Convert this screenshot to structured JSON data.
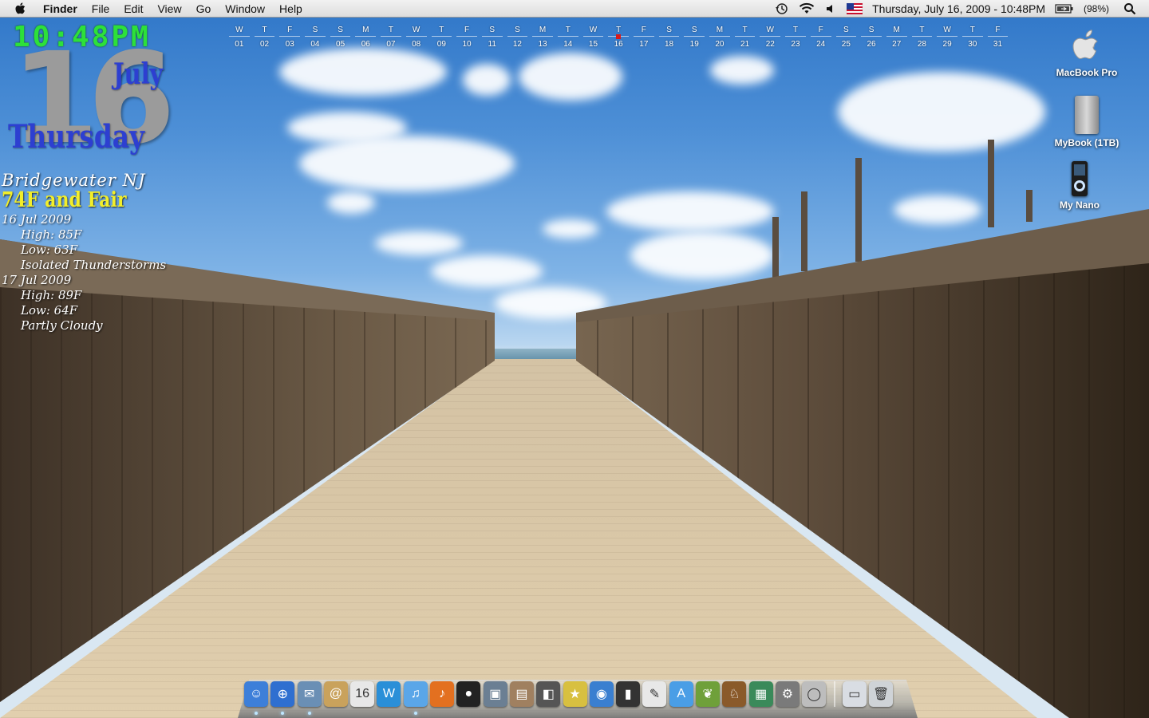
{
  "menubar": {
    "app_name": "Finder",
    "menus": [
      "File",
      "Edit",
      "View",
      "Go",
      "Window",
      "Help"
    ],
    "datetime": "Thursday, July 16, 2009 - 10:48PM",
    "battery": "(98%)"
  },
  "widgets": {
    "clock": "10:48PM",
    "day_number": "16",
    "month": "July",
    "weekday": "Thursday",
    "weather": {
      "city": "Bridgewater NJ",
      "current": "74F and Fair",
      "forecast": [
        {
          "date": "16 Jul 2009",
          "high": "High: 85F",
          "low": "Low: 63F",
          "condition": "Isolated Thunderstorms"
        },
        {
          "date": "17 Jul 2009",
          "high": "High: 89F",
          "low": "Low: 64F",
          "condition": "Partly Cloudy"
        }
      ]
    }
  },
  "calendar_strip": {
    "letters": [
      "W",
      "T",
      "F",
      "S",
      "S",
      "M",
      "T",
      "W",
      "T",
      "F",
      "S",
      "S",
      "M",
      "T",
      "W",
      "T",
      "F",
      "S",
      "S",
      "M",
      "T",
      "W",
      "T",
      "F",
      "S",
      "S",
      "M",
      "T",
      "W",
      "T",
      "F"
    ],
    "numbers": [
      "01",
      "02",
      "03",
      "04",
      "05",
      "06",
      "07",
      "08",
      "09",
      "10",
      "11",
      "12",
      "13",
      "14",
      "15",
      "16",
      "17",
      "18",
      "19",
      "20",
      "21",
      "22",
      "23",
      "24",
      "25",
      "26",
      "27",
      "28",
      "29",
      "30",
      "31"
    ],
    "today": "16"
  },
  "desktop_icons": [
    {
      "label": "MacBook Pro",
      "icon": "apple-hd-icon"
    },
    {
      "label": "MyBook (1TB)",
      "icon": "external-drive-icon"
    },
    {
      "label": "My Nano",
      "icon": "ipod-nano-icon"
    }
  ],
  "dock": {
    "apps": [
      {
        "name": "finder",
        "color": "#3d7fd9",
        "glyph": "☺"
      },
      {
        "name": "safari",
        "color": "#2f6fd0",
        "glyph": "⊕"
      },
      {
        "name": "mail",
        "color": "#6a8fb5",
        "glyph": "✉"
      },
      {
        "name": "address-book",
        "color": "#c9a25c",
        "glyph": "@"
      },
      {
        "name": "ical",
        "color": "#e8e8e8",
        "glyph": "16"
      },
      {
        "name": "dashboard",
        "color": "#2a8fd8",
        "glyph": "W"
      },
      {
        "name": "itunes",
        "color": "#5aa6e8",
        "glyph": "♫"
      },
      {
        "name": "garageband",
        "color": "#e37020",
        "glyph": "♪"
      },
      {
        "name": "photo-booth",
        "color": "#222222",
        "glyph": "●"
      },
      {
        "name": "iphoto",
        "color": "#6b7f93",
        "glyph": "▣"
      },
      {
        "name": "preview",
        "color": "#a08060",
        "glyph": "▤"
      },
      {
        "name": "box-app",
        "color": "#555555",
        "glyph": "◧"
      },
      {
        "name": "imovie",
        "color": "#d8c040",
        "glyph": "★"
      },
      {
        "name": "dvd-player",
        "color": "#3a7fd0",
        "glyph": "◉"
      },
      {
        "name": "ipod-app",
        "color": "#333333",
        "glyph": "▮"
      },
      {
        "name": "textedit",
        "color": "#e8e8e8",
        "glyph": "✎"
      },
      {
        "name": "app-store",
        "color": "#4a9ee6",
        "glyph": "A"
      },
      {
        "name": "pineapple-app",
        "color": "#6fa03a",
        "glyph": "❦"
      },
      {
        "name": "horse-app",
        "color": "#8a5a2a",
        "glyph": "♘"
      },
      {
        "name": "dashboard-tools",
        "color": "#3a8a5a",
        "glyph": "▦"
      },
      {
        "name": "system-preferences",
        "color": "#7a7a7a",
        "glyph": "⚙"
      },
      {
        "name": "generic-app",
        "color": "#bdbdbd",
        "glyph": "◯"
      }
    ],
    "right": [
      {
        "name": "documents-stack",
        "color": "#d9dde3",
        "glyph": "▭"
      },
      {
        "name": "trash",
        "color": "#cfd3d7",
        "glyph": "🗑"
      }
    ]
  }
}
